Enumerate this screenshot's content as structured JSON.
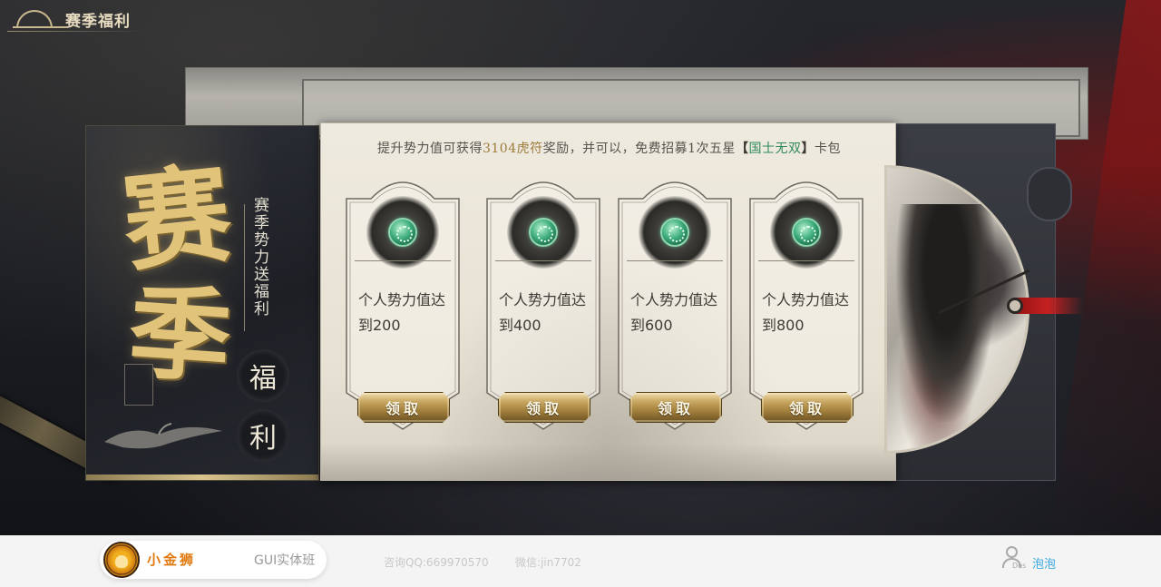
{
  "header": {
    "title": "赛季福利"
  },
  "banner": {
    "big_char_1": "赛",
    "big_char_2": "季",
    "vertical_text": "赛季势力送福利",
    "round_char_1": "福",
    "round_char_2": "利"
  },
  "panel": {
    "headline_pre": "提升势力值可获得",
    "headline_highlight": "3104虎符",
    "headline_mid": "奖励，并可以，免费招募1次五星",
    "headline_bracket_open": "【",
    "headline_card_name": "国士无双",
    "headline_bracket_close": "】",
    "headline_post": "卡包"
  },
  "rewards": [
    {
      "line1": "个人势力值达",
      "line2": "到200",
      "button": "领取"
    },
    {
      "line1": "个人势力值达",
      "line2": "到400",
      "button": "领取"
    },
    {
      "line1": "个人势力值达",
      "line2": "到600",
      "button": "领取"
    },
    {
      "line1": "个人势力值达",
      "line2": "到800",
      "button": "领取"
    }
  ],
  "footer": {
    "brand_name": "小金狮",
    "course": "GUI实体班",
    "qq": "咨询QQ:669970570",
    "wechat": "微信:jin7702",
    "user_tag": "Des",
    "author": "泡泡"
  },
  "colors": {
    "gold": "#e1c47a",
    "highlight": "#9c7b3a",
    "card_name_green": "#2f8a59",
    "author_blue": "#3aa7e0",
    "brand_orange": "#e07a10"
  },
  "icons": {
    "reward_gem": "jade-tiger-token-icon",
    "user": "user-icon",
    "brand_logo": "lion-logo-icon"
  }
}
